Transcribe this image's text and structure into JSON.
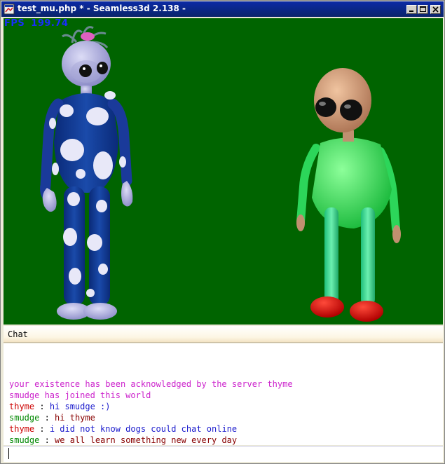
{
  "window": {
    "title": "test_mu.php * - Seamless3d 2.138 -"
  },
  "viewport": {
    "fps_label": "FPS",
    "fps_value": "199.74",
    "background_color": "#006400"
  },
  "chat": {
    "header": "Chat",
    "messages": [
      {
        "text": "your existence has been acknowledged by the server thyme",
        "color": "#cc22cc"
      },
      {
        "text": "smudge has joined this world",
        "color": "#cc22cc"
      },
      {
        "name": "thyme",
        "sep": " : ",
        "text": "hi smudge :)",
        "name_color": "#cc0000",
        "color": "#1a1acc"
      },
      {
        "name": "smudge",
        "sep": " : ",
        "text": "hi thyme",
        "name_color": "#008800",
        "color": "#880000"
      },
      {
        "name": "thyme",
        "sep": " : ",
        "text": "i did not know dogs could chat online",
        "name_color": "#cc0000",
        "color": "#1a1acc"
      },
      {
        "name": "smudge",
        "sep": " : ",
        "text": "we all learn something new every day",
        "name_color": "#008800",
        "color": "#880000"
      }
    ],
    "input_value": ""
  },
  "icons": {
    "app": "app-icon",
    "minimize": "minimize-icon",
    "maximize": "maximize-icon",
    "close": "close-icon"
  }
}
